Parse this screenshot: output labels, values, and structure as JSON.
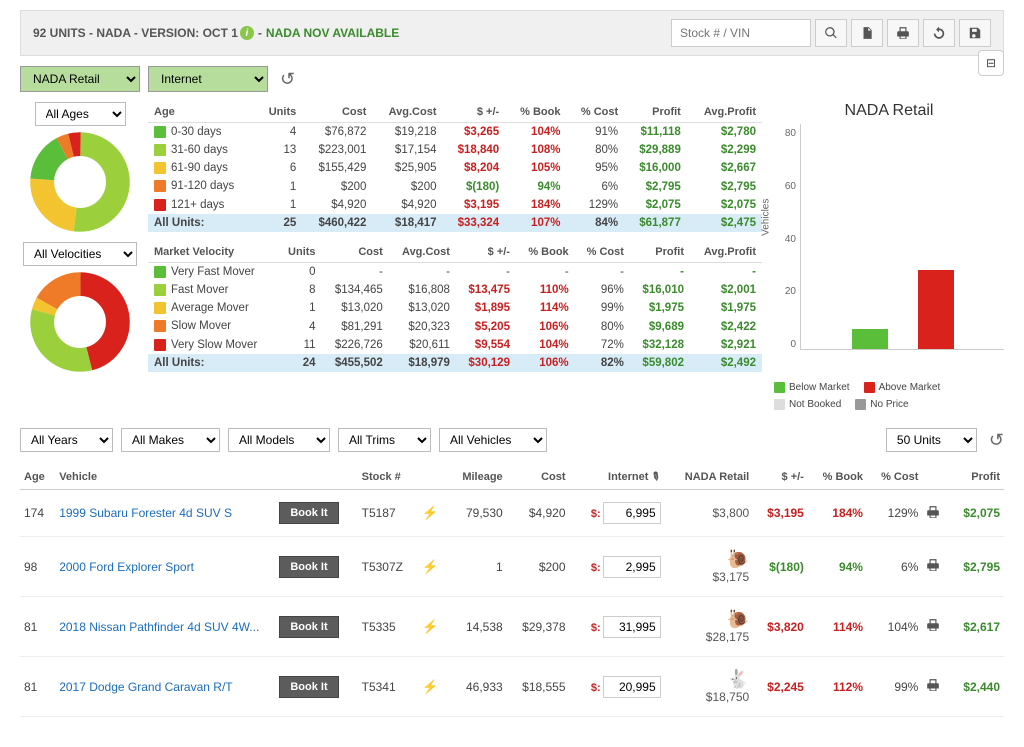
{
  "header": {
    "title": "92 UNITS - NADA - VERSION: OCT 1",
    "available": "NADA NOV AVAILABLE",
    "search_placeholder": "Stock # / VIN"
  },
  "selectors": {
    "guide": "NADA Retail",
    "source": "Internet"
  },
  "age_section": {
    "filter": "All Ages",
    "headers": [
      "Age",
      "Units",
      "Cost",
      "Avg.Cost",
      "$ +/-",
      "% Book",
      "% Cost",
      "Profit",
      "Avg.Profit"
    ],
    "rows": [
      {
        "chip": "c-green",
        "label": "0-30 days",
        "units": "4",
        "cost": "$76,872",
        "avg": "$19,218",
        "delta": "$3,265",
        "deltaClass": "neg",
        "book": "104%",
        "bookClass": "neg",
        "pcost": "91%",
        "profit": "$11,118",
        "avgprofit": "$2,780"
      },
      {
        "chip": "c-lime",
        "label": "31-60 days",
        "units": "13",
        "cost": "$223,001",
        "avg": "$17,154",
        "delta": "$18,840",
        "deltaClass": "neg",
        "book": "108%",
        "bookClass": "neg",
        "pcost": "80%",
        "profit": "$29,889",
        "avgprofit": "$2,299"
      },
      {
        "chip": "c-yellow",
        "label": "61-90 days",
        "units": "6",
        "cost": "$155,429",
        "avg": "$25,905",
        "delta": "$8,204",
        "deltaClass": "neg",
        "book": "105%",
        "bookClass": "neg",
        "pcost": "95%",
        "profit": "$16,000",
        "avgprofit": "$2,667"
      },
      {
        "chip": "c-orange",
        "label": "91-120 days",
        "units": "1",
        "cost": "$200",
        "avg": "$200",
        "delta": "$(180)",
        "deltaClass": "pos",
        "book": "94%",
        "bookClass": "pos",
        "pcost": "6%",
        "profit": "$2,795",
        "avgprofit": "$2,795"
      },
      {
        "chip": "c-red",
        "label": "121+ days",
        "units": "1",
        "cost": "$4,920",
        "avg": "$4,920",
        "delta": "$3,195",
        "deltaClass": "neg",
        "book": "184%",
        "bookClass": "neg",
        "pcost": "129%",
        "profit": "$2,075",
        "avgprofit": "$2,075"
      }
    ],
    "total": {
      "label": "All Units:",
      "units": "25",
      "cost": "$460,422",
      "avg": "$18,417",
      "delta": "$33,324",
      "book": "107%",
      "pcost": "84%",
      "profit": "$61,877",
      "avgprofit": "$2,475"
    }
  },
  "velocity_section": {
    "filter": "All Velocities",
    "headers": [
      "Market Velocity",
      "Units",
      "Cost",
      "Avg.Cost",
      "$ +/-",
      "% Book",
      "% Cost",
      "Profit",
      "Avg.Profit"
    ],
    "rows": [
      {
        "chip": "c-green",
        "label": "Very Fast Mover",
        "units": "0",
        "cost": "-",
        "avg": "-",
        "delta": "-",
        "deltaClass": "",
        "book": "-",
        "bookClass": "",
        "pcost": "-",
        "profit": "-",
        "avgprofit": "-"
      },
      {
        "chip": "c-lime",
        "label": "Fast Mover",
        "units": "8",
        "cost": "$134,465",
        "avg": "$16,808",
        "delta": "$13,475",
        "deltaClass": "neg",
        "book": "110%",
        "bookClass": "neg",
        "pcost": "96%",
        "profit": "$16,010",
        "avgprofit": "$2,001"
      },
      {
        "chip": "c-yellow",
        "label": "Average Mover",
        "units": "1",
        "cost": "$13,020",
        "avg": "$13,020",
        "delta": "$1,895",
        "deltaClass": "neg",
        "book": "114%",
        "bookClass": "neg",
        "pcost": "99%",
        "profit": "$1,975",
        "avgprofit": "$1,975"
      },
      {
        "chip": "c-orange",
        "label": "Slow Mover",
        "units": "4",
        "cost": "$81,291",
        "avg": "$20,323",
        "delta": "$5,205",
        "deltaClass": "neg",
        "book": "106%",
        "bookClass": "neg",
        "pcost": "80%",
        "profit": "$9,689",
        "avgprofit": "$2,422"
      },
      {
        "chip": "c-red",
        "label": "Very Slow Mover",
        "units": "11",
        "cost": "$226,726",
        "avg": "$20,611",
        "delta": "$9,554",
        "deltaClass": "neg",
        "book": "104%",
        "bookClass": "neg",
        "pcost": "72%",
        "profit": "$32,128",
        "avgprofit": "$2,921"
      }
    ],
    "total": {
      "label": "All Units:",
      "units": "24",
      "cost": "$455,502",
      "avg": "$18,979",
      "delta": "$30,129",
      "book": "106%",
      "pcost": "82%",
      "profit": "$59,802",
      "avgprofit": "$2,492"
    }
  },
  "chart_data": {
    "type": "bar",
    "title": "NADA Retail",
    "ylabel": "Vehicles",
    "ylim": [
      0,
      80
    ],
    "yticks": [
      0,
      20,
      40,
      60,
      80
    ],
    "series": [
      {
        "name": "Below Market",
        "color": "#5bbe3a",
        "value": 7
      },
      {
        "name": "Above Market",
        "color": "#d9221c",
        "value": 28
      }
    ],
    "legend": [
      {
        "name": "Below Market",
        "chip": "c-green"
      },
      {
        "name": "Above Market",
        "chip": "c-red"
      },
      {
        "name": "Not Booked",
        "chip": "c-ltgray"
      },
      {
        "name": "No Price",
        "chip": "c-gray"
      }
    ]
  },
  "filters": {
    "years": "All Years",
    "makes": "All Makes",
    "models": "All Models",
    "trims": "All Trims",
    "vehicles": "All Vehicles",
    "pagesize": "50 Units"
  },
  "vehicle_headers": [
    "Age",
    "Vehicle",
    "",
    "Stock #",
    "",
    "Mileage",
    "Cost",
    "Internet",
    "NADA Retail",
    "$ +/-",
    "% Book",
    "% Cost",
    "",
    "Profit"
  ],
  "book_label": "Book It",
  "vehicles": [
    {
      "age": "174",
      "name": "1999 Subaru Forester 4d SUV S",
      "stock": "T5187",
      "mileage": "79,530",
      "cost": "$4,920",
      "internet": "6,995",
      "retail": "$3,800",
      "retail_icon": "",
      "delta": "$3,195",
      "deltaClass": "neg",
      "book": "184%",
      "bookClass": "neg",
      "pcost": "129%",
      "profit": "$2,075"
    },
    {
      "age": "98",
      "name": "2000 Ford Explorer Sport",
      "stock": "T5307Z",
      "mileage": "1",
      "cost": "$200",
      "internet": "2,995",
      "retail": "$3,175",
      "retail_icon": "snail",
      "delta": "$(180)",
      "deltaClass": "pos",
      "book": "94%",
      "bookClass": "pos",
      "pcost": "6%",
      "profit": "$2,795"
    },
    {
      "age": "81",
      "name": "2018 Nissan Pathfinder 4d SUV 4W...",
      "stock": "T5335",
      "mileage": "14,538",
      "cost": "$29,378",
      "internet": "31,995",
      "retail": "$28,175",
      "retail_icon": "snail",
      "delta": "$3,820",
      "deltaClass": "neg",
      "book": "114%",
      "bookClass": "neg",
      "pcost": "104%",
      "profit": "$2,617"
    },
    {
      "age": "81",
      "name": "2017 Dodge Grand Caravan R/T",
      "stock": "T5341",
      "mileage": "46,933",
      "cost": "$18,555",
      "internet": "20,995",
      "retail": "$18,750",
      "retail_icon": "rabbit",
      "delta": "$2,245",
      "deltaClass": "neg",
      "book": "112%",
      "bookClass": "neg",
      "pcost": "99%",
      "profit": "$2,440"
    }
  ]
}
